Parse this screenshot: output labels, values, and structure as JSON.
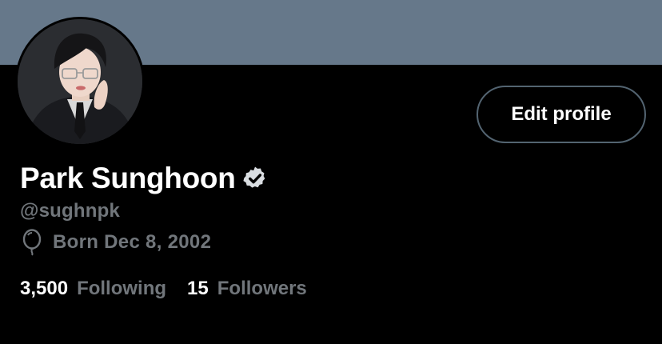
{
  "profile": {
    "display_name": "Park Sunghoon",
    "handle": "@sughnpk",
    "born": "Born Dec 8, 2002",
    "verified_icon": "verified-badge-icon",
    "birthday_icon": "balloon-icon"
  },
  "actions": {
    "edit_profile_label": "Edit profile"
  },
  "stats": {
    "following_count": "3,500",
    "following_label": "Following",
    "followers_count": "15",
    "followers_label": "Followers"
  },
  "colors": {
    "banner": "#66788a",
    "background": "#000000",
    "muted_text": "#71767b",
    "button_border": "#536471"
  }
}
